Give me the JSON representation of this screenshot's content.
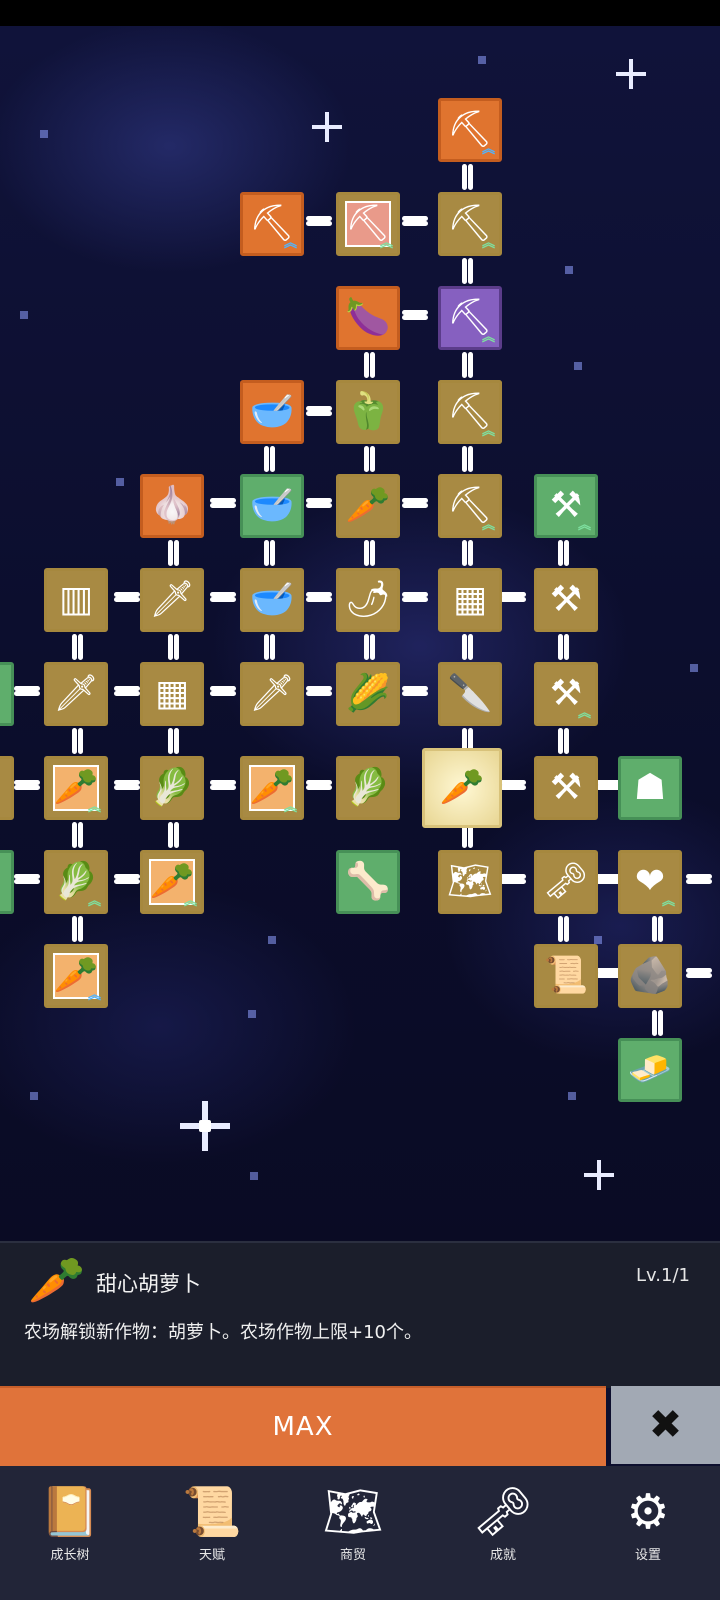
{
  "tree": {
    "nodes": [
      {
        "id": "n1",
        "icon": "shovel-icon",
        "glyph": "⛏",
        "color": "orange",
        "upgrade": "blue"
      },
      {
        "id": "n2",
        "icon": "shovel-icon",
        "glyph": "⛏",
        "color": "orange",
        "upgrade": "blue"
      },
      {
        "id": "n3",
        "icon": "shovel-icon",
        "glyph": "⛏",
        "color": "tan",
        "upgrade": "green"
      },
      {
        "id": "n4",
        "icon": "shovel-icon",
        "glyph": "⛏",
        "color": "tan",
        "upgrade": "green"
      },
      {
        "id": "n5",
        "icon": "eggplant-icon",
        "glyph": "🍆",
        "color": "orange"
      },
      {
        "id": "n6",
        "icon": "shovel-icon",
        "glyph": "⛏",
        "color": "purple",
        "upgrade": "green"
      },
      {
        "id": "n7",
        "icon": "bowl-icon",
        "glyph": "🥣",
        "color": "orange"
      },
      {
        "id": "n8",
        "icon": "pepper-icon",
        "glyph": "🫑",
        "color": "tan"
      },
      {
        "id": "n9",
        "icon": "shovel-icon",
        "glyph": "⛏",
        "color": "tan",
        "upgrade": "green"
      },
      {
        "id": "n10",
        "icon": "garlic-icon",
        "glyph": "🧄",
        "color": "orange"
      },
      {
        "id": "n11",
        "icon": "bowl-icon",
        "glyph": "🥣",
        "color": "green"
      },
      {
        "id": "n12",
        "icon": "radish-icon",
        "glyph": "🥕",
        "color": "tan"
      },
      {
        "id": "n13",
        "icon": "shovel-icon",
        "glyph": "⛏",
        "color": "tan",
        "upgrade": "green"
      },
      {
        "id": "n14",
        "icon": "pickaxe-icon",
        "glyph": "⚒",
        "color": "green",
        "upgrade": "green"
      },
      {
        "id": "n15",
        "icon": "crate-icon",
        "glyph": "▥",
        "color": "tan"
      },
      {
        "id": "n16",
        "icon": "sword-icon",
        "glyph": "🗡",
        "color": "tan"
      },
      {
        "id": "n17",
        "icon": "bowl-icon",
        "glyph": "🥣",
        "color": "tan"
      },
      {
        "id": "n18",
        "icon": "chili-icon",
        "glyph": "🌶",
        "color": "tan"
      },
      {
        "id": "n19",
        "icon": "crate-icon",
        "glyph": "▦",
        "color": "tan"
      },
      {
        "id": "n20",
        "icon": "pickaxe-icon",
        "glyph": "⚒",
        "color": "tan"
      },
      {
        "id": "n21",
        "icon": "sword-icon",
        "glyph": "🗡",
        "color": "tan"
      },
      {
        "id": "n22",
        "icon": "crate-icon",
        "glyph": "▦",
        "color": "tan"
      },
      {
        "id": "n23",
        "icon": "sword-icon",
        "glyph": "🗡",
        "color": "tan"
      },
      {
        "id": "n24",
        "icon": "corn-icon",
        "glyph": "🌽",
        "color": "tan"
      },
      {
        "id": "n25",
        "icon": "knife-icon",
        "glyph": "🔪",
        "color": "tan"
      },
      {
        "id": "n26",
        "icon": "pickaxe-icon",
        "glyph": "⚒",
        "color": "tan",
        "upgrade": "green"
      },
      {
        "id": "n27",
        "icon": "carrot-icon",
        "glyph": "🥕",
        "color": "inner-orange",
        "upgrade": "green"
      },
      {
        "id": "n28",
        "icon": "cabbage-icon",
        "glyph": "🥬",
        "color": "tan"
      },
      {
        "id": "n29",
        "icon": "carrot-icon",
        "glyph": "🥕",
        "color": "inner-orange",
        "upgrade": "green"
      },
      {
        "id": "n30",
        "icon": "cabbage-icon",
        "glyph": "🥬",
        "color": "tan"
      },
      {
        "id": "n31",
        "icon": "carrot-icon",
        "glyph": "🥕",
        "color": "glow"
      },
      {
        "id": "n32",
        "icon": "pickaxe-icon",
        "glyph": "⚒",
        "color": "tan"
      },
      {
        "id": "n33",
        "icon": "hooded-figure-icon",
        "glyph": "☗",
        "color": "green"
      },
      {
        "id": "n34",
        "icon": "cabbage-icon",
        "glyph": "🥬",
        "color": "tan",
        "upgrade": "green"
      },
      {
        "id": "n35",
        "icon": "carrot-icon",
        "glyph": "🥕",
        "color": "inner-orange",
        "upgrade": "green"
      },
      {
        "id": "n36",
        "icon": "bone-icon",
        "glyph": "🦴",
        "color": "green"
      },
      {
        "id": "n37",
        "icon": "map-icon",
        "glyph": "🗺",
        "color": "tan"
      },
      {
        "id": "n38",
        "icon": "key-icon",
        "glyph": "🗝",
        "color": "tan"
      },
      {
        "id": "n39",
        "icon": "heart-icon",
        "glyph": "❤",
        "color": "tan",
        "upgrade": "green"
      },
      {
        "id": "n40",
        "icon": "carrot-icon",
        "glyph": "🥕",
        "color": "inner-orange",
        "upgrade": "blue"
      },
      {
        "id": "n41",
        "icon": "scroll-icon",
        "glyph": "📜",
        "color": "tan"
      },
      {
        "id": "n42",
        "icon": "stone-icon",
        "glyph": "🪨",
        "color": "tan"
      },
      {
        "id": "n43",
        "icon": "butter-icon",
        "glyph": "🧈",
        "color": "green"
      },
      {
        "id": "n44",
        "icon": "shovel-icon",
        "glyph": "⛏",
        "color": "inner-pink",
        "upgrade": "green"
      }
    ]
  },
  "info": {
    "icon": "carrot-icon",
    "icon_glyph": "🥕",
    "title": "甜心胡萝卜",
    "level": "Lv.1/1",
    "description": "农场解锁新作物：胡萝卜。农场作物上限+10个。"
  },
  "actions": {
    "max_label": "MAX",
    "close_glyph": "✖"
  },
  "nav": [
    {
      "label": "成长树",
      "icon": "book-icon",
      "glyph": "📔"
    },
    {
      "label": "天赋",
      "icon": "scroll-icon",
      "glyph": "📜"
    },
    {
      "label": "商贸",
      "icon": "map-icon",
      "glyph": "🗺"
    },
    {
      "label": "成就",
      "icon": "key-icon",
      "glyph": "🗝"
    },
    {
      "label": "设置",
      "icon": "gear-icon",
      "glyph": "⚙"
    }
  ]
}
